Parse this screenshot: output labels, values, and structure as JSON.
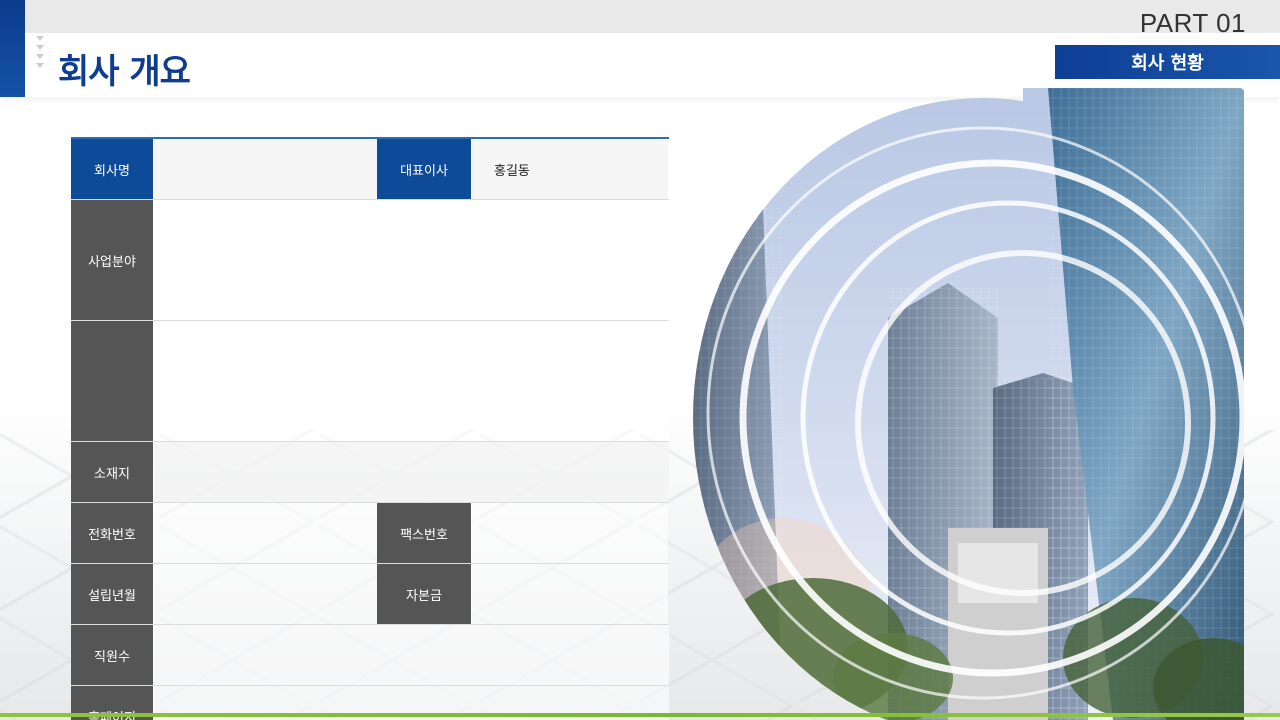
{
  "header": {
    "title": "회사 개요",
    "part": "PART 01",
    "section": "회사 현황"
  },
  "table": {
    "company_name_label": "회사명",
    "company_name_value": "",
    "ceo_label": "대표이사",
    "ceo_value": "홍길동",
    "business_label": "사업분야",
    "business_value": "",
    "extra_label": "",
    "extra_value": "",
    "location_label": "소재지",
    "location_value": "",
    "phone_label": "전화번호",
    "phone_value": "",
    "fax_label": "팩스번호",
    "fax_value": "",
    "founded_label": "설립년월",
    "founded_value": "",
    "capital_label": "자본금",
    "capital_value": "",
    "employees_label": "직원수",
    "employees_value": "",
    "homepage_label": "홈페이지",
    "homepage_value": ""
  },
  "colors": {
    "brand_blue": "#0d4a97",
    "label_grey": "#555555",
    "accent_green": "#8fc33e"
  }
}
